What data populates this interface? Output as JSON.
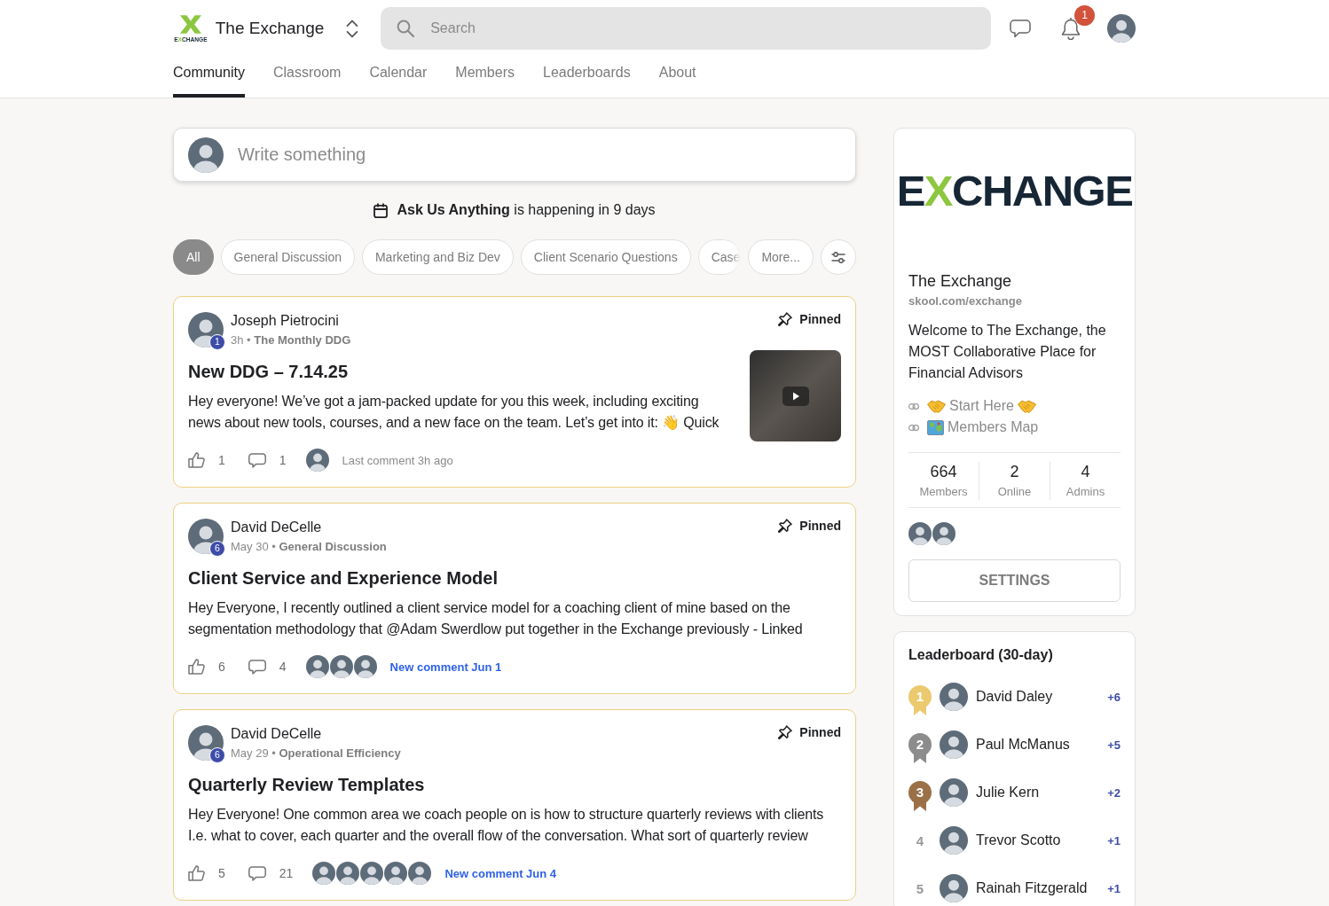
{
  "header": {
    "logo_caption": "EXCHANGE",
    "community_name": "The Exchange",
    "search": {
      "placeholder": "Search"
    },
    "notification_count": "1"
  },
  "tabs": [
    {
      "label": "Community",
      "selected": true
    },
    {
      "label": "Classroom",
      "selected": false
    },
    {
      "label": "Calendar",
      "selected": false
    },
    {
      "label": "Members",
      "selected": false
    },
    {
      "label": "Leaderboards",
      "selected": false
    },
    {
      "label": "About",
      "selected": false
    }
  ],
  "composer": {
    "placeholder": "Write something"
  },
  "event": {
    "text": "**Ask Us Anything** is happening in 9 days"
  },
  "filters": {
    "chips": [
      {
        "label": "All",
        "selected": true
      },
      {
        "label": "General Discussion",
        "selected": false
      },
      {
        "label": "Marketing and Biz Dev",
        "selected": false
      },
      {
        "label": "Client Scenario Questions",
        "selected": false
      },
      {
        "label": "Case",
        "selected": false
      }
    ],
    "more": "More..."
  },
  "posts": [
    {
      "author": "Joseph Pietrocini",
      "level": "1",
      "meta": "3h • **The Monthly DDG**",
      "pinned": true,
      "pin_label": "Pinned",
      "title": "New DDG – 7.14.25",
      "body": "Hey everyone! We’ve got a jam-packed update for you this week, including exciting news about new tools, courses, and a new face on the team. Let’s get into it: 👋 Quick",
      "thumbnail": {
        "kind": "video"
      },
      "likes": "1",
      "comments": "1",
      "commenters": [
        {
          "kind": "photo"
        }
      ],
      "activity": {
        "text": "Last comment 3h ago",
        "new": false
      }
    },
    {
      "author": "David DeCelle",
      "level": "6",
      "meta": "May 30 • **General Discussion**",
      "pinned": true,
      "pin_label": "Pinned",
      "title": "Client Service and Experience Model",
      "body": "Hey Everyone, I recently outlined a client service model for a coaching client of mine based on the segmentation methodology that @Adam Swerdlow put together in the Exchange previously - Linked",
      "likes": "6",
      "comments": "4",
      "commenters": [
        {
          "kind": "photo"
        },
        {
          "kind": "photo"
        },
        {
          "kind": "photo"
        }
      ],
      "activity": {
        "text": "New comment Jun 1",
        "new": true
      }
    },
    {
      "author": "David DeCelle",
      "level": "6",
      "meta": "May 29 • **Operational Efficiency**",
      "pinned": true,
      "pin_label": "Pinned",
      "title": "Quarterly Review Templates",
      "body": "Hey Everyone! One common area we coach people on is how to structure quarterly reviews with clients I.e. what to cover, each quarter and the overall flow of the conversation. What sort of quarterly review",
      "likes": "5",
      "comments": "21",
      "commenters": [
        {
          "kind": "photo"
        },
        {
          "kind": "photo"
        },
        {
          "kind": "photo"
        },
        {
          "kind": "photo"
        },
        {
          "kind": "photo"
        }
      ],
      "activity": {
        "text": "New comment Jun 4",
        "new": true
      }
    }
  ],
  "about": {
    "banner_logo": "EXCHANGE",
    "name": "The Exchange",
    "url": "skool.com/exchange",
    "description": "Welcome to The Exchange, the MOST Collaborative Place for Financial Advisors",
    "links": [
      {
        "label": "Start Here",
        "kind": "handshake"
      },
      {
        "label": "Members Map",
        "kind": "map"
      }
    ],
    "stats": [
      {
        "value": "664",
        "label": "Members"
      },
      {
        "value": "2",
        "label": "Online"
      },
      {
        "value": "4",
        "label": "Admins"
      }
    ],
    "member_avatars": [
      {
        "kind": "photo"
      },
      {
        "kind": "photo"
      }
    ],
    "settings_button": "SETTINGS"
  },
  "leaderboard": {
    "title": "Leaderboard (30-day)",
    "rows": [
      {
        "rank": "1",
        "color": "#ebc96f",
        "name": "David Daley",
        "points": "+6"
      },
      {
        "rank": "2",
        "color": "#8c8c8c",
        "name": "Paul McManus",
        "points": "+5"
      },
      {
        "rank": "3",
        "color": "#9b7047",
        "name": "Julie Kern",
        "points": "+2"
      },
      {
        "rank": "4",
        "name": "Trevor Scotto",
        "points": "+1"
      },
      {
        "rank": "5",
        "name": "Rainah Fitzgerald",
        "points": "+1"
      }
    ]
  }
}
